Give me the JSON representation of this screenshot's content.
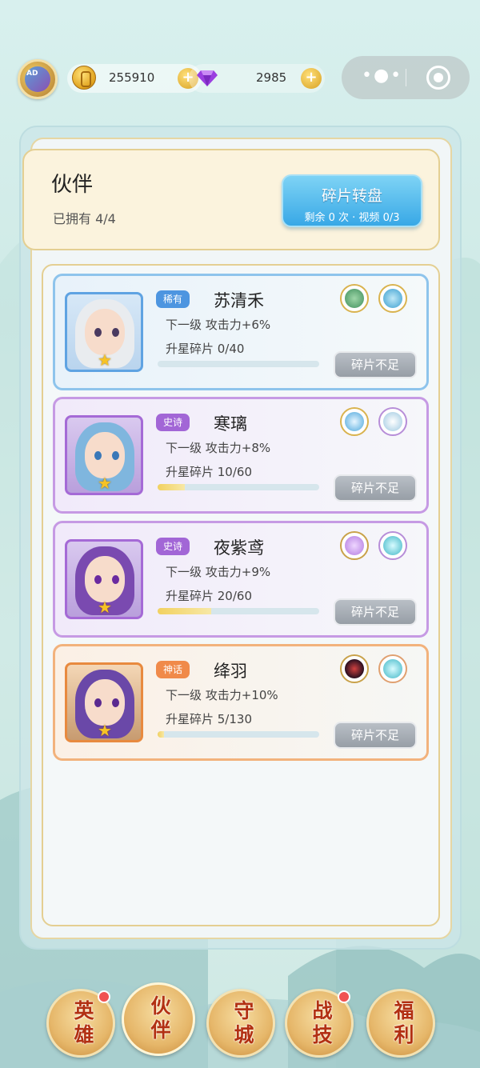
{
  "topbar": {
    "gold": "255910",
    "gems": "2985",
    "plus": "+",
    "avatar_text": "AD"
  },
  "header": {
    "title": "伙伴",
    "owned": "已拥有 4/4",
    "wheel_button": "碎片转盘",
    "wheel_sub": "剩余 0 次 · 视频 0/3"
  },
  "partners": [
    {
      "rarity": "稀有",
      "name": "苏清禾",
      "next": "下一级 攻击力+6%",
      "shards": "升星碎片 0/40",
      "progress": 0.0,
      "button": "碎片不足"
    },
    {
      "rarity": "史诗",
      "name": "寒璃",
      "next": "下一级 攻击力+8%",
      "shards": "升星碎片 10/60",
      "progress": 0.167,
      "button": "碎片不足"
    },
    {
      "rarity": "史诗",
      "name": "夜紫鸢",
      "next": "下一级 攻击力+9%",
      "shards": "升星碎片 20/60",
      "progress": 0.333,
      "button": "碎片不足"
    },
    {
      "rarity": "神话",
      "name": "绛羽",
      "next": "下一级 攻击力+10%",
      "shards": "升星碎片 5/130",
      "progress": 0.038,
      "button": "碎片不足"
    }
  ],
  "nav": [
    {
      "label": "英雄",
      "badge": true
    },
    {
      "label": "伙伴",
      "badge": false,
      "active": true
    },
    {
      "label": "守城",
      "badge": false
    },
    {
      "label": "战技",
      "badge": true
    },
    {
      "label": "福利",
      "badge": false
    }
  ],
  "colors": {
    "rare": "#4d95e0",
    "epic": "#a266d6",
    "myth": "#f08a4a",
    "wheel_button": "#38a8e6",
    "progress_fill": "#f2d160"
  }
}
